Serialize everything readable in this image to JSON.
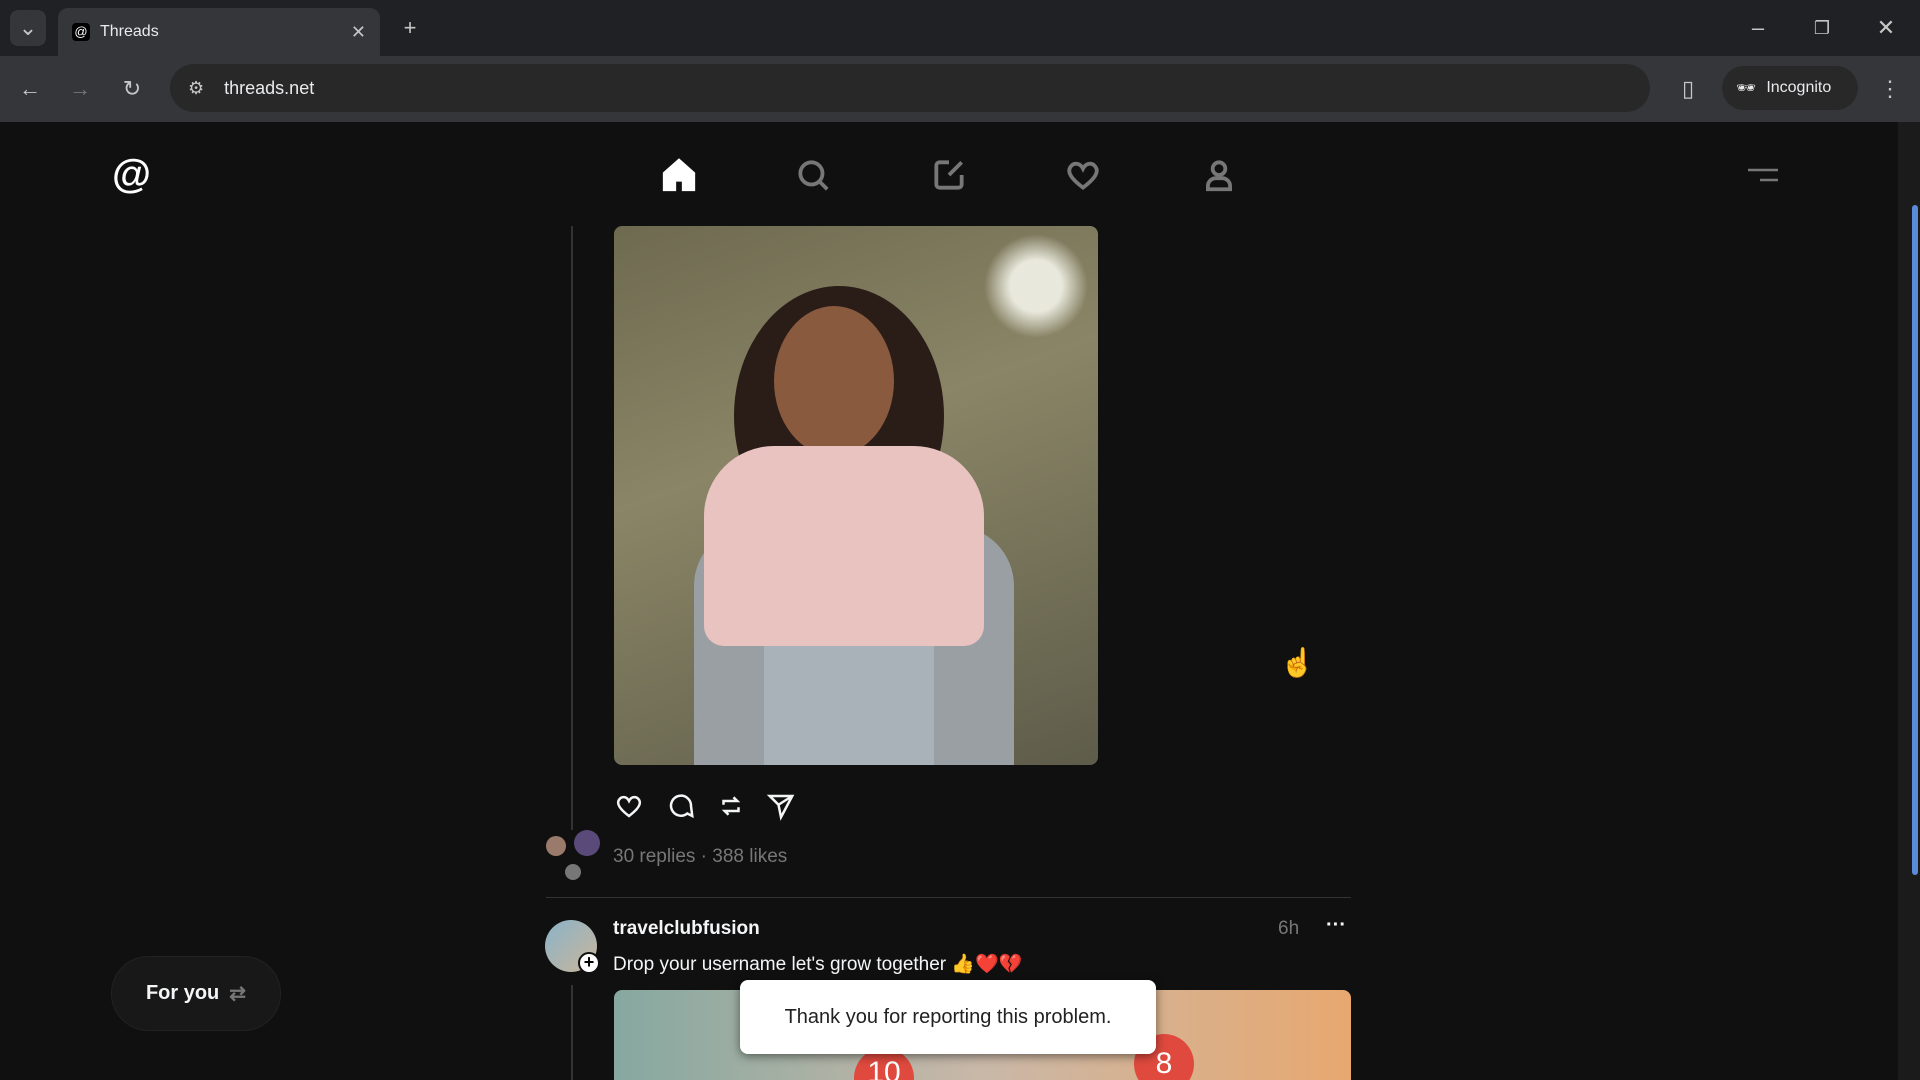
{
  "browser": {
    "tab_title": "Threads",
    "url": "threads.net",
    "incognito_label": "Incognito"
  },
  "nav": {
    "items": [
      "home",
      "search",
      "create",
      "activity",
      "profile"
    ],
    "active": "home"
  },
  "post1": {
    "replies": "30 replies",
    "separator": "·",
    "likes": "388 likes"
  },
  "post2": {
    "username": "travelclubfusion",
    "time": "6h",
    "more": "···",
    "text": "Drop your username let's grow together 👍❤️💔",
    "image_badges": [
      "10",
      "8"
    ]
  },
  "toast": {
    "message": "Thank you for reporting this problem."
  },
  "feed_switch": {
    "label": "For you",
    "icon": "⇄"
  }
}
